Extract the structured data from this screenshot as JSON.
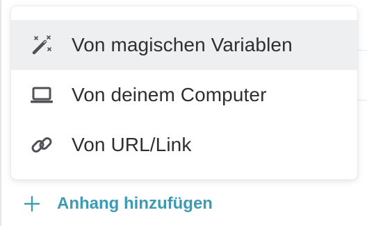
{
  "menu": {
    "items": [
      {
        "label": "Von magischen Variablen",
        "icon": "magic-wand-icon",
        "active": true
      },
      {
        "label": "Von deinem Computer",
        "icon": "laptop-icon",
        "active": false
      },
      {
        "label": "Von URL/Link",
        "icon": "link-icon",
        "active": false
      }
    ]
  },
  "add_attachment": {
    "label": "Anhang hinzufügen",
    "icon": "plus-icon"
  },
  "colors": {
    "accent": "#3c9bb3",
    "text": "#2e2e33",
    "icon": "#505055",
    "active_bg": "#eeeff1"
  }
}
